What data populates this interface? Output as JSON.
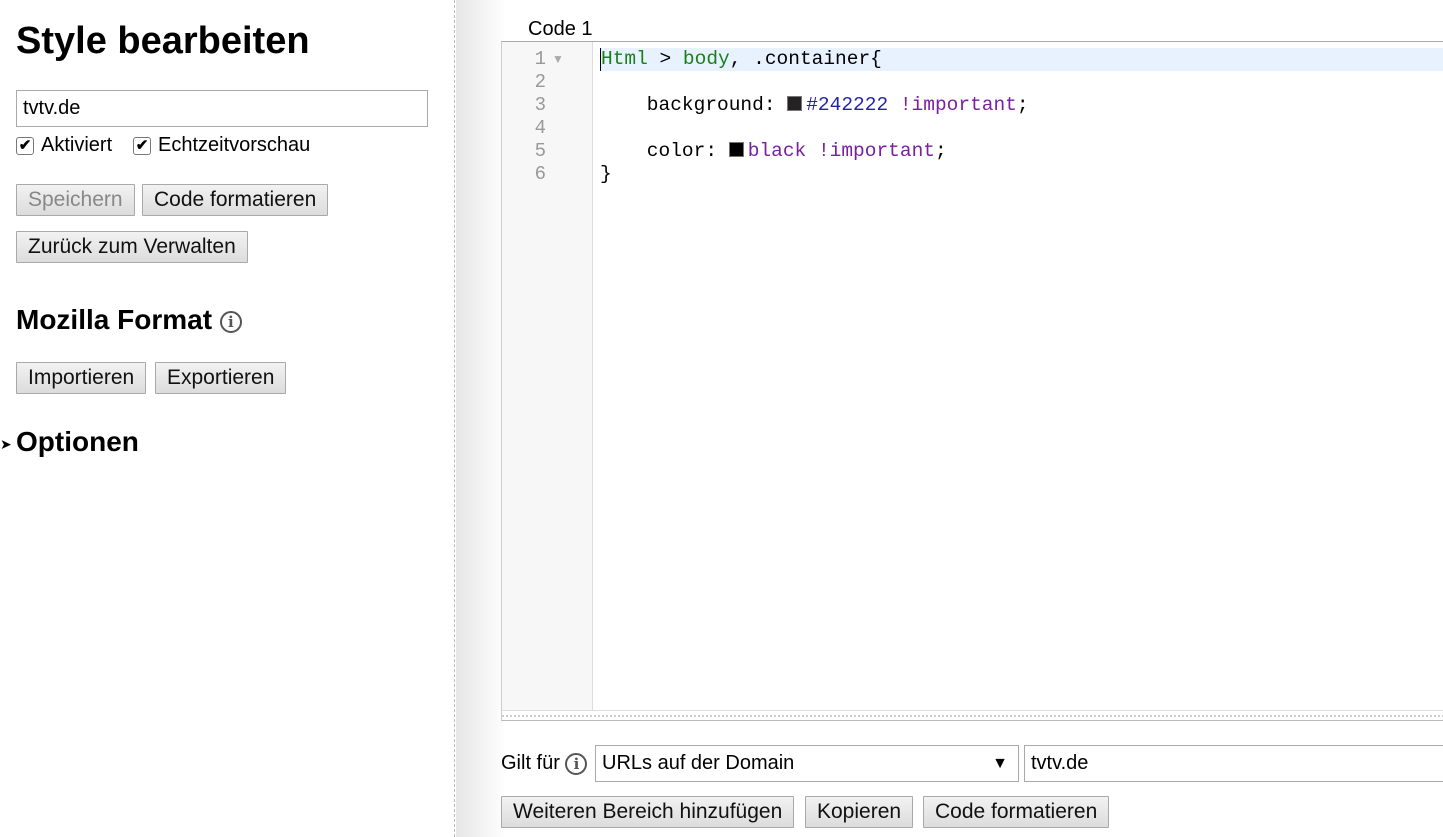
{
  "left": {
    "title": "Style bearbeiten",
    "name_value": "tvtv.de",
    "enabled_label": "Aktiviert",
    "live_preview_label": "Echtzeitvorschau",
    "save": "Speichern",
    "format": "Code formatieren",
    "back": "Zurück zum Verwalten",
    "mozilla_heading": "Mozilla Format",
    "import": "Importieren",
    "export": "Exportieren",
    "options_heading": "Optionen"
  },
  "editor": {
    "section_label": "Code 1",
    "line_numbers": [
      "1",
      "2",
      "3",
      "4",
      "5",
      "6"
    ],
    "line1": {
      "a": "Html",
      "b": " > ",
      "c": "body",
      "d": ", .container{"
    },
    "line3": {
      "prop": "    background: ",
      "color_hex": "#242222",
      "value": "#242222",
      "imp": " !important",
      "end": ";"
    },
    "line5": {
      "prop": "    color: ",
      "color_hex": "#000000",
      "value": "black",
      "imp": " !important",
      "end": ";"
    },
    "line6": "}"
  },
  "applies": {
    "label": "Gilt für",
    "type_value": "URLs auf der Domain",
    "domain_value": "tvtv.de",
    "add": "Weiteren Bereich hinzufügen",
    "copy": "Kopieren",
    "format": "Code formatieren"
  }
}
